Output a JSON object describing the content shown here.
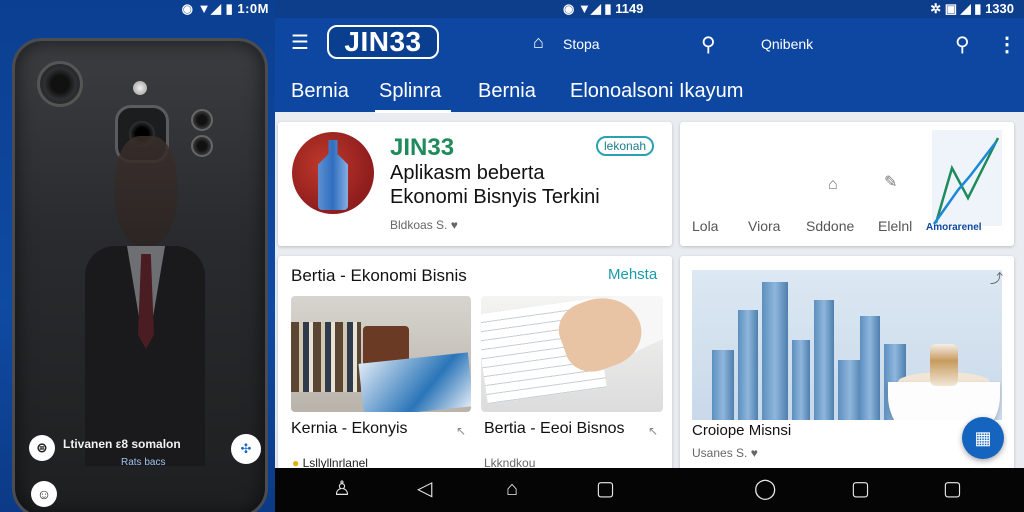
{
  "left": {
    "status": "1:0M",
    "caption_title": "Ltivanen ε8 somalon",
    "caption_sub": "Rats bacs",
    "caption_icon": "⊜",
    "fab_icon": "share-icon",
    "smile_icon": "smile-icon"
  },
  "statusbar": {
    "mid": "1149",
    "right": "1330"
  },
  "appbar": {
    "logo": "JIN33",
    "user_label": "Stopa",
    "search_label": "Qnibenk",
    "tabs": [
      "Bernia",
      "Splinra",
      "Bernia",
      "Elonoalsoni Ikayum"
    ]
  },
  "hero": {
    "brand": "JIN33",
    "tag": "lekonah",
    "line1": "Aplikasm beberta",
    "line2": "Ekonomi Bisnyis Terkini",
    "meta": "Bldkoas S."
  },
  "stats": {
    "labels": [
      "Lola",
      "Viora",
      "Sddone",
      "Elelnl"
    ],
    "chart_caption": "Amorarenel"
  },
  "news": {
    "title": "Bertia - Ekonomi Bisnis",
    "link": "Mehsta",
    "cap1": "Kernia - Ekonyis",
    "cap2": "Bertia - Eeoi Bisnos",
    "foot1": "Lsllyllnrlanel",
    "foot2": "Lkkndkou"
  },
  "city": {
    "caption": "Croiope Misnsi",
    "meta": "Usanes S."
  },
  "colors": {
    "primary": "#0d47a1",
    "accent": "#1f8a5b",
    "tag": "#2aa0b3"
  }
}
